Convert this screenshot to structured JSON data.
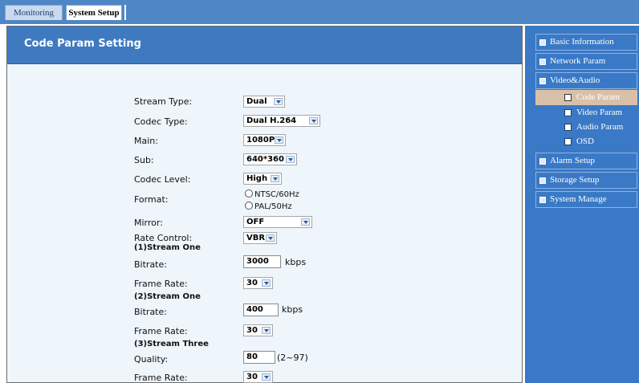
{
  "tabs": {
    "monitoring": "Monitoring",
    "system_setup": "System Setup"
  },
  "panel": {
    "title": "Code Param Setting"
  },
  "form": {
    "stream_type": {
      "label": "Stream Type:",
      "value": "Dual"
    },
    "codec_type": {
      "label": "Codec Type:",
      "value": "Dual H.264"
    },
    "main": {
      "label": "Main:",
      "value": "1080P"
    },
    "sub": {
      "label": "Sub:",
      "value": "640*360"
    },
    "codec_level": {
      "label": "Codec Level:",
      "value": "High"
    },
    "format": {
      "label": "Format:",
      "options": [
        "NTSC/60Hz",
        "PAL/50Hz"
      ]
    },
    "mirror": {
      "label": "Mirror:",
      "value": "OFF"
    },
    "rate_control": {
      "label": "Rate Control:",
      "value": "VBR"
    },
    "stream1": {
      "heading": "(1)Stream One",
      "bitrate_label": "Bitrate:",
      "bitrate": "3000",
      "bitrate_unit": "kbps",
      "frame_rate_label": "Frame Rate:",
      "frame_rate": "30"
    },
    "stream2": {
      "heading": "(2)Stream One",
      "bitrate_label": "Bitrate:",
      "bitrate": "400",
      "bitrate_unit": "kbps",
      "frame_rate_label": "Frame Rate:",
      "frame_rate": "30"
    },
    "stream3": {
      "heading": "(3)Stream Three",
      "quality_label": "Quality:",
      "quality": "80",
      "quality_range": "(2~97)",
      "frame_rate_label": "Frame Rate:",
      "frame_rate": "30"
    }
  },
  "sidebar": {
    "items": [
      {
        "label": "Basic Information"
      },
      {
        "label": "Network Param"
      },
      {
        "label": "Video&Audio"
      },
      {
        "label": "Alarm Setup"
      },
      {
        "label": "Storage Setup"
      },
      {
        "label": "System Manage"
      }
    ],
    "video_audio_sub": [
      {
        "label": "Code Param",
        "active": true
      },
      {
        "label": "Video Param"
      },
      {
        "label": "Audio Param"
      },
      {
        "label": "OSD"
      }
    ]
  },
  "colors": {
    "header_blue": "#3f7ac0",
    "sidebar_blue": "#3a79c6",
    "active_item": "#d9c1a9",
    "panel_bg": "#eef5fb"
  }
}
